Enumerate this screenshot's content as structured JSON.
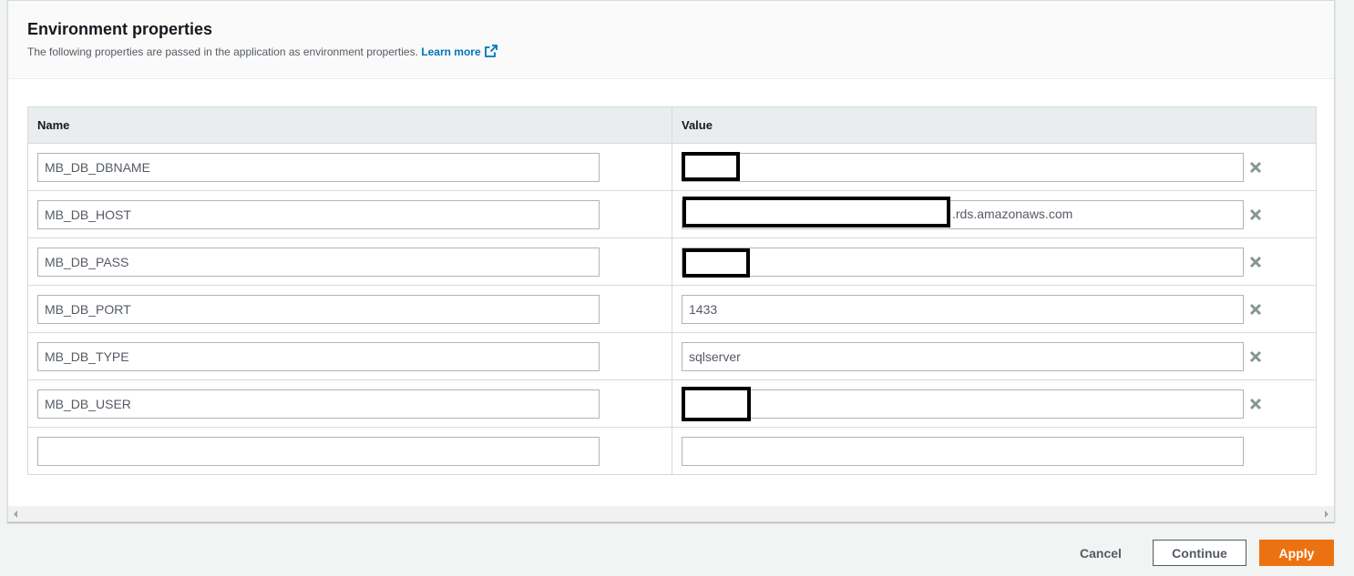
{
  "panel": {
    "title": "Environment properties",
    "description": "The following properties are passed in the application as environment properties.",
    "learn_more": "Learn more"
  },
  "table": {
    "headers": {
      "name": "Name",
      "value": "Value"
    },
    "rows": [
      {
        "name": "MB_DB_DBNAME",
        "value": "",
        "redacted": true
      },
      {
        "name": "MB_DB_HOST",
        "value": ".rds.amazonaws.com",
        "redacted": true
      },
      {
        "name": "MB_DB_PASS",
        "value": "",
        "redacted": true
      },
      {
        "name": "MB_DB_PORT",
        "value": "1433",
        "redacted": false
      },
      {
        "name": "MB_DB_TYPE",
        "value": "sqlserver",
        "redacted": false
      },
      {
        "name": "MB_DB_USER",
        "value": "",
        "redacted": true
      }
    ],
    "new_row": {
      "name": "",
      "value": ""
    }
  },
  "footer": {
    "cancel": "Cancel",
    "continue": "Continue",
    "apply": "Apply"
  },
  "colors": {
    "accent": "#ec7211",
    "link": "#0073bb",
    "header_bg": "#eaeded"
  },
  "icons": {
    "external_link": "external-link-icon",
    "remove": "close-icon"
  }
}
